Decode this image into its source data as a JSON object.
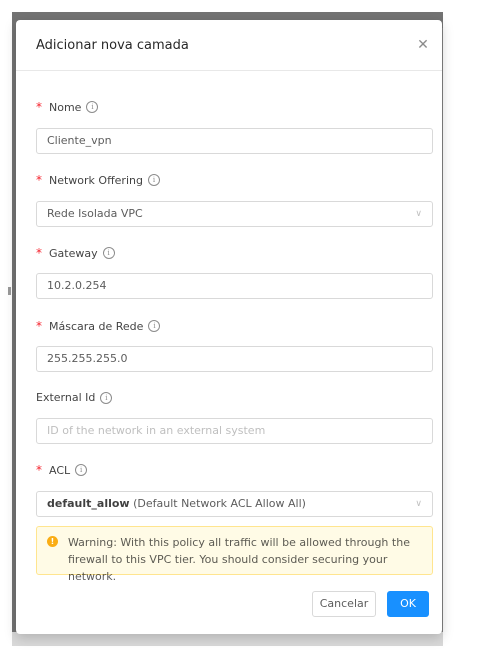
{
  "modal": {
    "title": "Adicionar nova camada",
    "close_icon": "close-icon"
  },
  "fields": {
    "name": {
      "label": "Nome",
      "required": true,
      "value": "Cliente_vpn"
    },
    "network_offering": {
      "label": "Network Offering",
      "required": true,
      "value": "Rede Isolada VPC"
    },
    "gateway": {
      "label": "Gateway",
      "required": true,
      "value": "10.2.0.254"
    },
    "netmask": {
      "label": "Máscara de Rede",
      "required": true,
      "value": "255.255.255.0"
    },
    "external_id": {
      "label": "External Id",
      "required": false,
      "value": "",
      "placeholder": "ID of the network in an external system"
    },
    "acl": {
      "label": "ACL",
      "required": true,
      "value_strong": "default_allow",
      "value_rest": "(Default Network ACL Allow All)"
    }
  },
  "warning": {
    "text": "Warning: With this policy all traffic will be allowed through the firewall to this VPC tier. You should consider securing your network."
  },
  "buttons": {
    "cancel": "Cancelar",
    "ok": "OK"
  },
  "icons": {
    "info": "info-icon",
    "chevron": "chevron-down-icon",
    "warning": "warning-icon"
  },
  "colors": {
    "primary": "#1890ff",
    "required": "#f5222d",
    "warning_bg": "#fffbe6",
    "warning_border": "#ffe58f",
    "warning_icon": "#faad14"
  }
}
